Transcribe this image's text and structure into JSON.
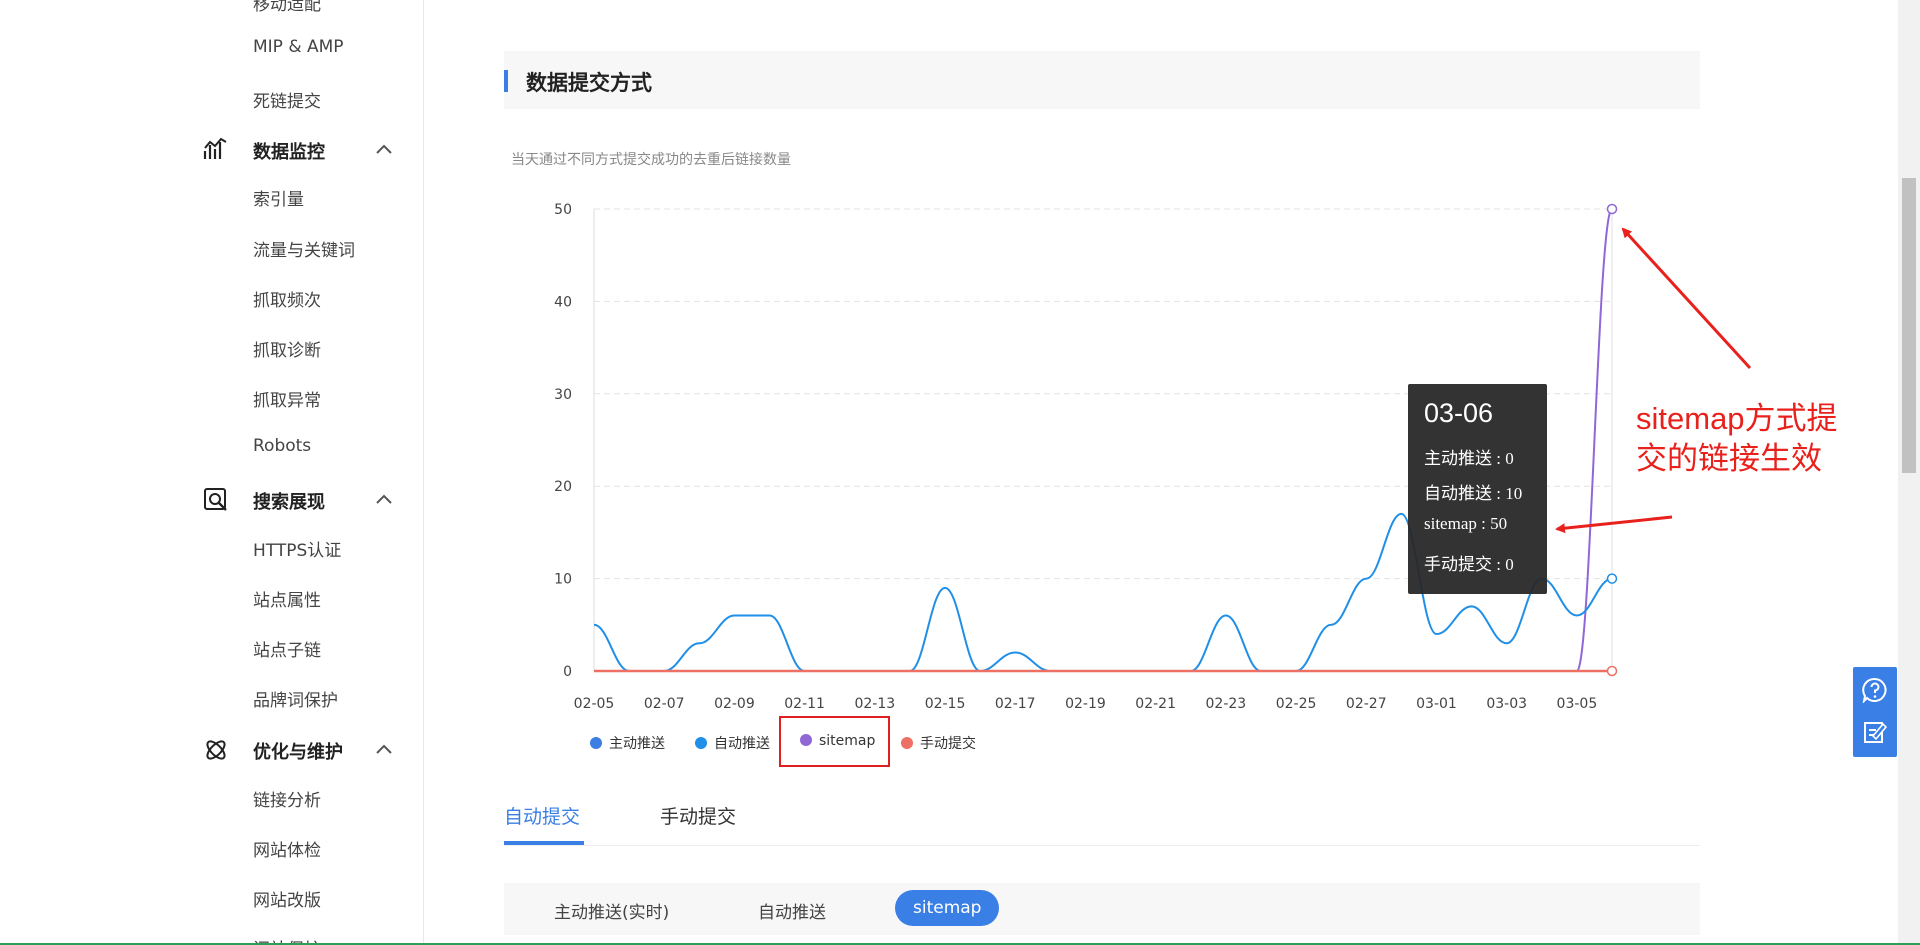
{
  "sidebar": {
    "top_cut": "移动适配",
    "items_a": [
      "MIP & AMP",
      "死链提交"
    ],
    "group_monitor": {
      "label": "数据监控",
      "icon": "chart-monitor-icon",
      "items": [
        "索引量",
        "流量与关键词",
        "抓取频次",
        "抓取诊断",
        "抓取异常",
        "Robots"
      ]
    },
    "group_search": {
      "label": "搜索展现",
      "icon": "search-display-icon",
      "items": [
        "HTTPS认证",
        "站点属性",
        "站点子链",
        "品牌词保护"
      ]
    },
    "group_optimize": {
      "label": "优化与维护",
      "icon": "optimize-atom-icon",
      "items": [
        "链接分析",
        "网站体检",
        "网站改版"
      ]
    },
    "bottom_cut": "闭站保护"
  },
  "section": {
    "title": "数据提交方式",
    "subtitle": "当天通过不同方式提交成功的去重后链接数量"
  },
  "chart_data": {
    "type": "line",
    "x_ticks": [
      "02-05",
      "02-07",
      "02-09",
      "02-11",
      "02-13",
      "02-15",
      "02-17",
      "02-19",
      "02-21",
      "02-23",
      "02-25",
      "02-27",
      "03-01",
      "03-03",
      "03-05"
    ],
    "y_ticks": [
      "0",
      "10",
      "20",
      "30",
      "40",
      "50"
    ],
    "ylim": [
      0,
      50
    ],
    "grid": "horizontal dashed",
    "legend_position": "bottom-left",
    "categories": [
      "02-05",
      "02-06",
      "02-07",
      "02-08",
      "02-09",
      "02-10",
      "02-11",
      "02-12",
      "02-13",
      "02-14",
      "02-15",
      "02-16",
      "02-17",
      "02-18",
      "02-19",
      "02-20",
      "02-21",
      "02-22",
      "02-23",
      "02-24",
      "02-25",
      "02-26",
      "02-27",
      "02-28",
      "03-01",
      "03-02",
      "03-03",
      "03-04",
      "03-05",
      "03-06"
    ],
    "series": [
      {
        "name": "主动推送",
        "color": "#3d7ee3",
        "values": [
          0,
          0,
          0,
          0,
          0,
          0,
          0,
          0,
          0,
          0,
          0,
          0,
          0,
          0,
          0,
          0,
          0,
          0,
          0,
          0,
          0,
          0,
          0,
          0,
          0,
          0,
          0,
          0,
          0,
          0
        ]
      },
      {
        "name": "自动推送",
        "color": "#1f8fe8",
        "values": [
          5,
          0,
          0,
          3,
          6,
          6,
          0,
          0,
          0,
          0,
          9,
          0,
          2,
          0,
          0,
          0,
          0,
          0,
          6,
          0,
          0,
          5,
          10,
          17,
          4,
          7,
          3,
          10,
          6,
          10
        ]
      },
      {
        "name": "sitemap",
        "color": "#8f68d6",
        "values": [
          0,
          0,
          0,
          0,
          0,
          0,
          0,
          0,
          0,
          0,
          0,
          0,
          0,
          0,
          0,
          0,
          0,
          0,
          0,
          0,
          0,
          0,
          0,
          0,
          0,
          0,
          0,
          0,
          0,
          50
        ]
      },
      {
        "name": "手动提交",
        "color": "#ec7063",
        "values": [
          0,
          0,
          0,
          0,
          0,
          0,
          0,
          0,
          0,
          0,
          0,
          0,
          0,
          0,
          0,
          0,
          0,
          0,
          0,
          0,
          0,
          0,
          0,
          0,
          0,
          0,
          0,
          0,
          0,
          0
        ]
      }
    ]
  },
  "tooltip": {
    "date": "03-06",
    "rows": [
      "主动推送 : 0",
      "自动推送 : 10",
      "sitemap : 50",
      "手动提交 : 0"
    ]
  },
  "annotation": {
    "text_line1": "sitemap方式提",
    "text_line2": "交的链接生效",
    "color": "#e8211d"
  },
  "tabs": {
    "auto": "自动提交",
    "manual": "手动提交"
  },
  "subtabs": {
    "active_push": "主动推送(实时)",
    "auto_push": "自动推送",
    "sitemap": "sitemap"
  },
  "float": {
    "help_icon": "question-icon",
    "feedback_icon": "feedback-edit-icon"
  }
}
